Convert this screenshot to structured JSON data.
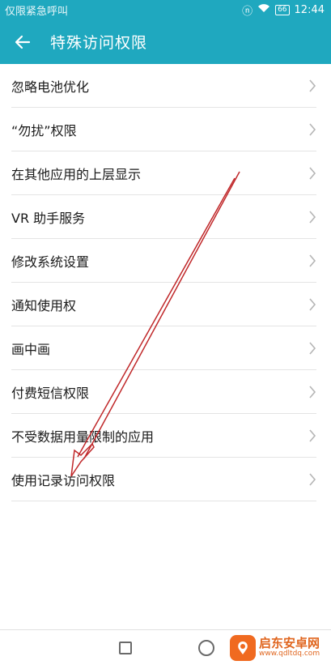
{
  "status_bar": {
    "carrier": "仅限紧急呼叫",
    "battery": "66",
    "time": "12:44"
  },
  "app_bar": {
    "title": "特殊访问权限"
  },
  "items": [
    {
      "label": "忽略电池优化"
    },
    {
      "label": "“勿扰”权限"
    },
    {
      "label": "在其他应用的上层显示"
    },
    {
      "label": "VR 助手服务"
    },
    {
      "label": "修改系统设置"
    },
    {
      "label": "通知使用权"
    },
    {
      "label": "画中画"
    },
    {
      "label": "付费短信权限"
    },
    {
      "label": "不受数据用量限制的应用"
    },
    {
      "label": "使用记录访问权限"
    }
  ],
  "watermark": {
    "name": "启东安卓网",
    "url": "www.qdltdq.com"
  },
  "colors": {
    "accent": "#1fa8bf",
    "annotation": "#c0282a"
  }
}
